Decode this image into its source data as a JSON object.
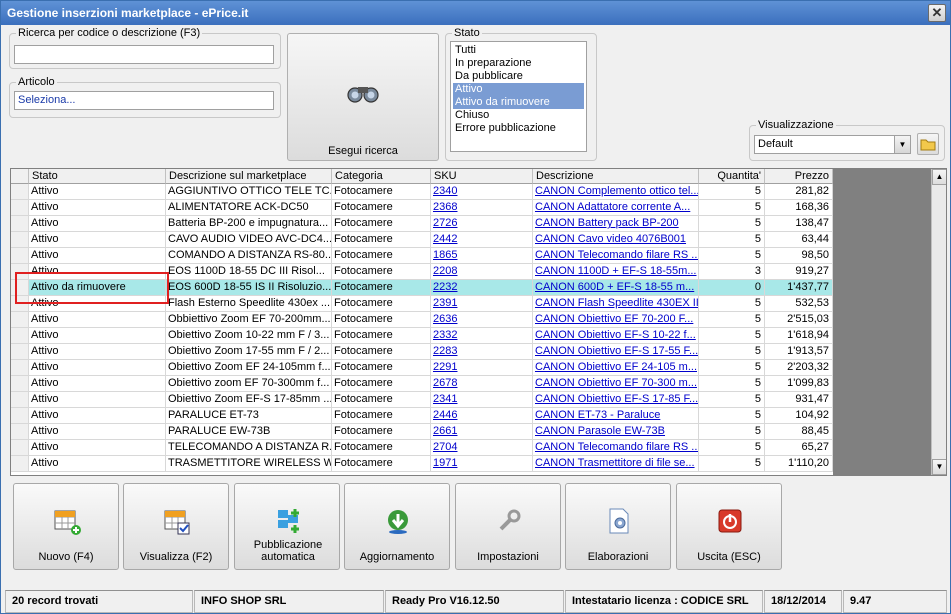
{
  "window": {
    "title": "Gestione inserzioni marketplace - ePrice.it"
  },
  "search": {
    "code_label": "Ricerca per codice o descrizione (F3)",
    "code_value": "",
    "article_label": "Articolo",
    "article_value": "Seleziona...",
    "button_label": "Esegui ricerca"
  },
  "state": {
    "label": "Stato",
    "options": [
      "Tutti",
      "In preparazione",
      "Da pubblicare",
      "Attivo",
      "Attivo da rimuovere",
      "Chiuso",
      "Errore pubblicazione"
    ],
    "selected": [
      "Attivo",
      "Attivo da rimuovere"
    ]
  },
  "view": {
    "label": "Visualizzazione",
    "value": "Default"
  },
  "table": {
    "columns": [
      "Stato",
      "Descrizione sul marketplace",
      "Categoria",
      "SKU",
      "Descrizione",
      "Quantita'",
      "Prezzo"
    ],
    "rows": [
      [
        "Attivo",
        "AGGIUNTIVO OTTICO TELE TC...",
        "Fotocamere",
        "2340",
        "CANON Complemento ottico tel...",
        "5",
        "281,82"
      ],
      [
        "Attivo",
        "ALIMENTATORE ACK-DC50",
        "Fotocamere",
        "2368",
        "CANON Adattatore corrente A...",
        "5",
        "168,36"
      ],
      [
        "Attivo",
        "Batteria BP-200 e impugnatura...",
        "Fotocamere",
        "2726",
        "CANON Battery pack BP-200",
        "5",
        "138,47"
      ],
      [
        "Attivo",
        "CAVO AUDIO VIDEO AVC-DC4...",
        "Fotocamere",
        "2442",
        "CANON Cavo video 4076B001",
        "5",
        "63,44"
      ],
      [
        "Attivo",
        "COMANDO A DISTANZA RS-80...",
        "Fotocamere",
        "1865",
        "CANON Telecomando filare RS ...",
        "5",
        "98,50"
      ],
      [
        "Attivo",
        "EOS 1100D 18-55 DC III Risol...",
        "Fotocamere",
        "2208",
        "CANON 1100D + EF-S 18-55m...",
        "3",
        "919,27"
      ],
      [
        "Attivo da rimuovere",
        "EOS 600D 18-55 IS II Risoluzio...",
        "Fotocamere",
        "2232",
        "CANON 600D + EF-S 18-55 m...",
        "0",
        "1'437,77"
      ],
      [
        "Attivo",
        "Flash Esterno Speedlite 430ex ...",
        "Fotocamere",
        "2391",
        "CANON Flash Speedlite 430EX II",
        "5",
        "532,53"
      ],
      [
        "Attivo",
        "Obbiettivo Zoom EF 70-200mm...",
        "Fotocamere",
        "2636",
        "CANON Obiettivo EF 70-200 F...",
        "5",
        "2'515,03"
      ],
      [
        "Attivo",
        "Obiettivo Zoom 10-22 mm F / 3...",
        "Fotocamere",
        "2332",
        "CANON Obiettivo EF-S 10-22 f...",
        "5",
        "1'618,94"
      ],
      [
        "Attivo",
        "Obiettivo Zoom 17-55 mm F / 2...",
        "Fotocamere",
        "2283",
        "CANON Obiettivo EF-S 17-55 F...",
        "5",
        "1'913,57"
      ],
      [
        "Attivo",
        "Obiettivo Zoom EF 24-105mm f...",
        "Fotocamere",
        "2291",
        "CANON Obiettivo EF 24-105 m...",
        "5",
        "2'203,32"
      ],
      [
        "Attivo",
        "Obiettivo zoom EF 70-300mm f...",
        "Fotocamere",
        "2678",
        "CANON Obiettivo EF 70-300 m...",
        "5",
        "1'099,83"
      ],
      [
        "Attivo",
        "Obiettivo Zoom EF-S 17-85mm ...",
        "Fotocamere",
        "2341",
        "CANON Obiettivo EF-S 17-85 F...",
        "5",
        "931,47"
      ],
      [
        "Attivo",
        "PARALUCE ET-73",
        "Fotocamere",
        "2446",
        "CANON ET-73 - Paraluce",
        "5",
        "104,92"
      ],
      [
        "Attivo",
        "PARALUCE EW-73B",
        "Fotocamere",
        "2661",
        "CANON Parasole EW-73B",
        "5",
        "88,45"
      ],
      [
        "Attivo",
        "TELECOMANDO A DISTANZA R...",
        "Fotocamere",
        "2704",
        "CANON Telecomando filare RS ...",
        "5",
        "65,27"
      ],
      [
        "Attivo",
        "TRASMETTITORE WIRELESS W...",
        "Fotocamere",
        "1971",
        "CANON Trasmettitore di file se...",
        "5",
        "1'110,20"
      ]
    ]
  },
  "buttons": [
    {
      "label": "Nuovo (F4)",
      "icon": "grid-add-icon"
    },
    {
      "label": "Visualizza (F2)",
      "icon": "grid-check-icon"
    },
    {
      "label": "Pubblicazione automatica",
      "icon": "publish-icon"
    },
    {
      "label": "Aggiornamento",
      "icon": "refresh-globe-icon"
    },
    {
      "label": "Impostazioni",
      "icon": "wrench-icon"
    },
    {
      "label": "Elaborazioni",
      "icon": "document-gear-icon"
    },
    {
      "label": "Uscita (ESC)",
      "icon": "power-icon"
    }
  ],
  "statusbar": {
    "records": "20 record trovati",
    "company": "INFO SHOP SRL",
    "version": "Ready Pro V16.12.50",
    "license": "Intestatario licenza : CODICE SRL",
    "date": "18/12/2014",
    "time": "9.47"
  }
}
